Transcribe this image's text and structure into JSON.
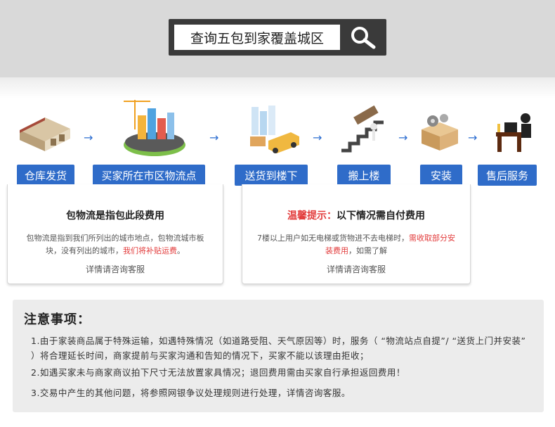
{
  "search": {
    "text": "查询五包到家覆盖城区",
    "icon": "magnifier-icon"
  },
  "steps": [
    {
      "label": "仓库发货",
      "icon": "warehouse-icon"
    },
    {
      "label": "买家所在市区物流点",
      "icon": "city-icon"
    },
    {
      "label": "送货到楼下",
      "icon": "delivery-truck-icon"
    },
    {
      "label": "搬上楼",
      "icon": "carry-stairs-icon"
    },
    {
      "label": "安装",
      "icon": "gears-box-icon"
    },
    {
      "label": "售后服务",
      "icon": "customer-service-icon"
    }
  ],
  "card_left": {
    "title": "包物流是指包此段费用",
    "body_a": "包物流是指到我们所列出的城市地点，包物流城市板块，没有列出的城市，",
    "body_red": "我们将补贴运费",
    "body_b": "。",
    "footer": "详情请咨询客服"
  },
  "card_right": {
    "title_warn": "温馨提示：",
    "title_rest": "以下情况需自付费用",
    "body_a": "7楼以上用户如无电梯或货物进不去电梯时，",
    "body_red": "需收取部分安装费用",
    "body_b": "，如需了解",
    "footer": "详情请咨询客服"
  },
  "notes": {
    "title": "注意事项：",
    "items": [
      "1.由于家装商品属于特殊运输，如遇特殊情况（如道路受阻、天气原因等）时，服务（ “物流站点自提”/ “送货上门并安装” ）将合理延长时间，商家提前与买家沟通和告知的情况下，买家不能以该理由拒收；",
      "2.如遇买家未与商家商议拍下尺寸无法放置家具情况；退回费用需由买家自行承担返回费用！",
      "3.交易中产生的其他问题，将参照网银争议处理规则进行处理，详情咨询客服。"
    ]
  },
  "colors": {
    "accent": "#2f6cc9",
    "warning": "#e23b3b",
    "band": "#d9d9d9"
  }
}
